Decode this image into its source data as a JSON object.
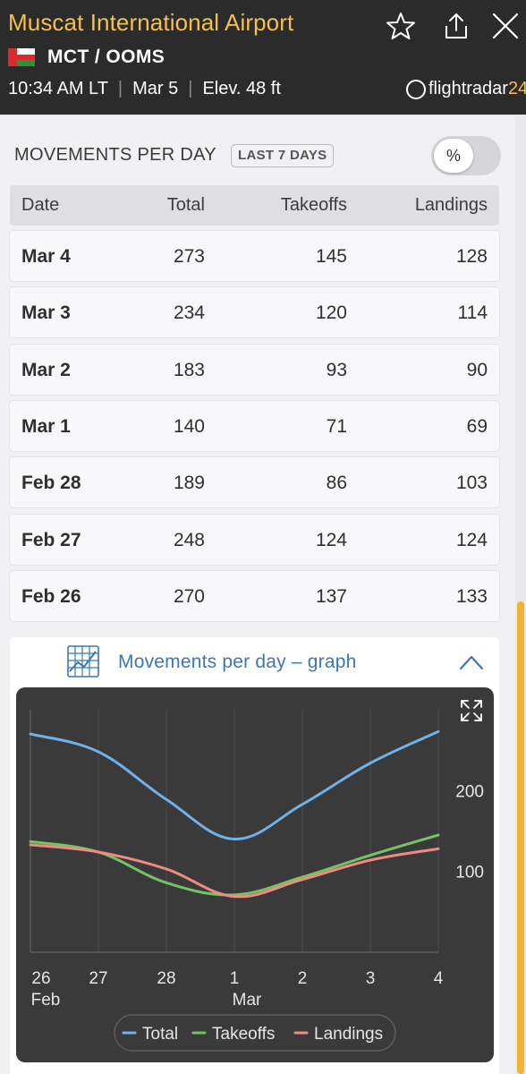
{
  "header": {
    "airport_name": "Muscat International Airport",
    "codes": "MCT / OOMS",
    "time": "10:34 AM LT",
    "date": "Mar 5",
    "elevation": "Elev. 48 ft",
    "brand_main": "flightradar",
    "brand_num": "24",
    "icons": [
      "star-icon",
      "share-icon",
      "close-icon"
    ]
  },
  "movements": {
    "title": "MOVEMENTS PER DAY",
    "badge": "LAST 7 DAYS",
    "toggle_label": "%",
    "columns": [
      "Date",
      "Total",
      "Takeoffs",
      "Landings"
    ],
    "rows": [
      {
        "date": "Mar 4",
        "total": "273",
        "takeoffs": "145",
        "landings": "128"
      },
      {
        "date": "Mar 3",
        "total": "234",
        "takeoffs": "120",
        "landings": "114"
      },
      {
        "date": "Mar 2",
        "total": "183",
        "takeoffs": "93",
        "landings": "90"
      },
      {
        "date": "Mar 1",
        "total": "140",
        "takeoffs": "71",
        "landings": "69"
      },
      {
        "date": "Feb 28",
        "total": "189",
        "takeoffs": "86",
        "landings": "103"
      },
      {
        "date": "Feb 27",
        "total": "248",
        "takeoffs": "124",
        "landings": "124"
      },
      {
        "date": "Feb 26",
        "total": "270",
        "takeoffs": "137",
        "landings": "133"
      }
    ]
  },
  "graph": {
    "title": "Movements per day – graph"
  },
  "colors": {
    "header_bg": "#2b2b2b",
    "accent_yellow": "#f2c14e",
    "link_blue": "#3b77b5",
    "total": "#6fb1e8",
    "takeoffs": "#74c465",
    "landings": "#ef8a84"
  },
  "chart_data": {
    "type": "line",
    "x": [
      "26 Feb",
      "27",
      "28",
      "1 Mar",
      "2",
      "3",
      "4"
    ],
    "x_tick_top": [
      "26",
      "27",
      "28",
      "1",
      "2",
      "3",
      "4"
    ],
    "x_tick_bottom": [
      "Feb",
      "",
      "",
      "Mar",
      "",
      "",
      ""
    ],
    "y_ticks": [
      "100",
      "200"
    ],
    "ylim": [
      0,
      300
    ],
    "series": [
      {
        "name": "Total",
        "values": [
          270,
          248,
          189,
          140,
          183,
          234,
          273
        ]
      },
      {
        "name": "Takeoffs",
        "values": [
          137,
          124,
          86,
          71,
          93,
          120,
          145
        ]
      },
      {
        "name": "Landings",
        "values": [
          133,
          124,
          103,
          69,
          90,
          114,
          128
        ]
      }
    ],
    "legend_position": "bottom"
  }
}
